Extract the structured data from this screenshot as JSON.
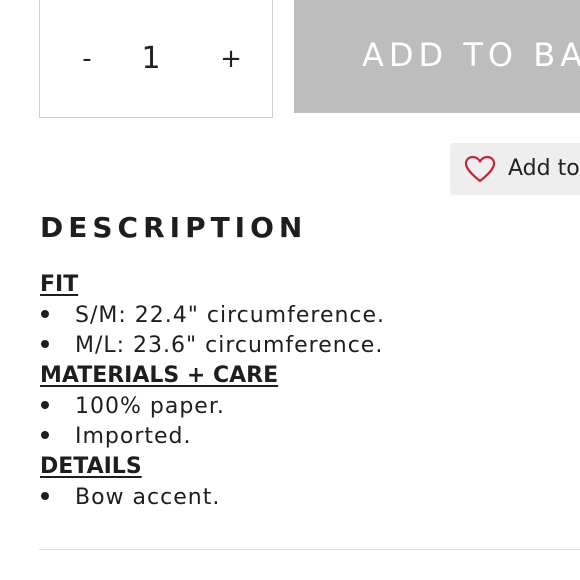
{
  "quantity": {
    "minus_label": "-",
    "value": "1",
    "plus_label": "+"
  },
  "add_to_bag": {
    "label": "ADD TO BA"
  },
  "wishlist": {
    "label": "Add to",
    "icon": "heart-outline-icon",
    "icon_color": "#c0283c"
  },
  "colors": {
    "button_bg": "#bdbdbd",
    "wishlist_bg": "#eeeeee",
    "text": "#1e1e1e"
  },
  "description": {
    "heading": "DESCRIPTION",
    "sections": [
      {
        "title": "FIT",
        "items": [
          "S/M: 22.4\" circumference.",
          "M/L: 23.6\" circumference."
        ]
      },
      {
        "title": "MATERIALS + CARE",
        "items": [
          "100% paper.",
          "Imported."
        ]
      },
      {
        "title": "DETAILS",
        "items": [
          "Bow accent."
        ]
      }
    ]
  }
}
